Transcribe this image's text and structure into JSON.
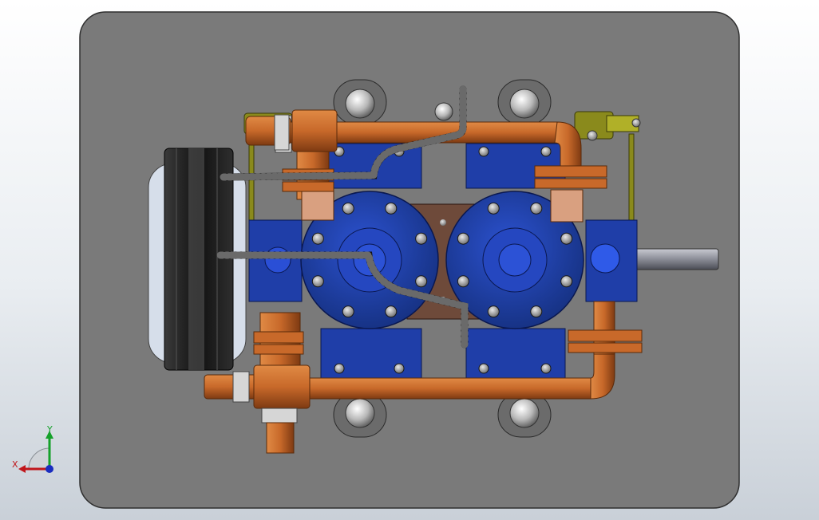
{
  "viewport": {
    "background_top": "#ffffff",
    "background_bottom": "#c9d0d8"
  },
  "model": {
    "plate_color": "#7b7b7b",
    "body_color": "#1f3ea8",
    "body_dark": "#0f2270",
    "copper_color": "#c8692a",
    "copper_dark": "#8c4216",
    "brass_color": "#8a8a1c",
    "pulley_color": "#1a1a1a",
    "pulley_glass": "#d9e2ee",
    "bolt_color": "#b9b9b9",
    "shaft_color": "#9a9ca6",
    "hose_color": "#2a2a2a",
    "block_color": "#6e4a3a"
  },
  "triad": {
    "x_label": "X",
    "y_label": "Y",
    "x_color": "#c0161b",
    "y_color": "#15a12a",
    "z_color": "#1a2dbf"
  }
}
